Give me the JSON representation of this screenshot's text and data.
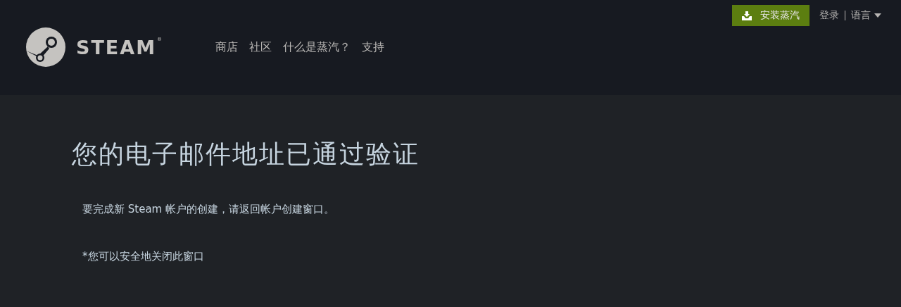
{
  "logo": {
    "wordmark": "STEAM",
    "mark": "®"
  },
  "nav": [
    "商店",
    "社区",
    "什么是蒸汽？",
    "支持"
  ],
  "top_bar": {
    "install_button": "安装蒸汽",
    "login": "登录",
    "language": "语言"
  },
  "content": {
    "title": "您的电子邮件地址已通过验证",
    "message": "要完成新 Steam 帐户的创建，请返回帐户创建窗口。",
    "note": "*您可以安全地关闭此窗口"
  }
}
